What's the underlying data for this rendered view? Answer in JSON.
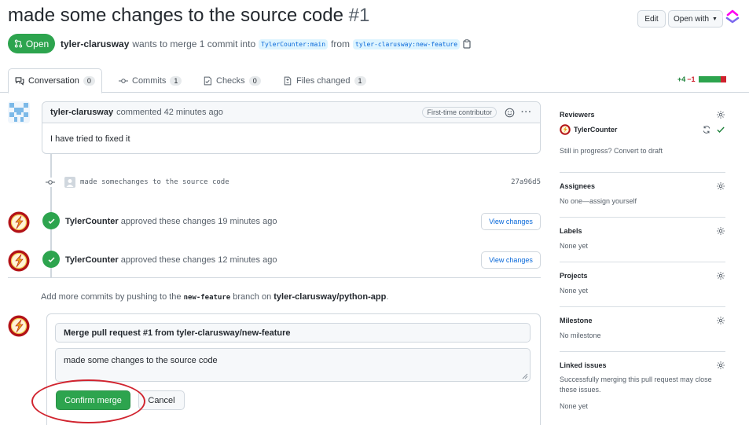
{
  "header": {
    "title": "made some changes to the source code",
    "number": "#1",
    "edit_label": "Edit",
    "open_with_label": "Open with"
  },
  "pr": {
    "state": "Open",
    "author": "tyler-clarusway",
    "merge_text": "wants to merge 1 commit into",
    "base_branch": "TylerCounter:main",
    "from_text": "from",
    "head_branch": "tyler-clarusway:new-feature"
  },
  "tabs": [
    {
      "label": "Conversation",
      "count": "0"
    },
    {
      "label": "Commits",
      "count": "1"
    },
    {
      "label": "Checks",
      "count": "0"
    },
    {
      "label": "Files changed",
      "count": "1"
    }
  ],
  "diffstat": {
    "additions": "+4",
    "deletions": "−1"
  },
  "comment": {
    "author": "tyler-clarusway",
    "meta": "commented 42 minutes ago",
    "badge": "First-time contributor",
    "body": "I have tried to fixed it"
  },
  "commit": {
    "message": "made somechanges to the source code",
    "sha": "27a96d5"
  },
  "reviews": [
    {
      "reviewer": "TylerCounter",
      "text": "approved these changes 19 minutes ago",
      "button": "View changes"
    },
    {
      "reviewer": "TylerCounter",
      "text": "approved these changes 12 minutes ago",
      "button": "View changes"
    }
  ],
  "hint": {
    "prefix": "Add more commits by pushing to the",
    "branch": "new-feature",
    "mid": "branch on",
    "repo": "tyler-clarusway/python-app",
    "suffix": "."
  },
  "merge": {
    "title": "Merge pull request #1 from tyler-clarusway/new-feature",
    "message": "made some changes to the source code",
    "confirm_label": "Confirm merge",
    "cancel_label": "Cancel"
  },
  "sidebar": {
    "reviewers": {
      "heading": "Reviewers",
      "name": "TylerCounter",
      "status": "Still in progress? Convert to draft"
    },
    "assignees": {
      "heading": "Assignees",
      "text": "No one—assign yourself"
    },
    "labels": {
      "heading": "Labels",
      "text": "None yet"
    },
    "projects": {
      "heading": "Projects",
      "text": "None yet"
    },
    "milestone": {
      "heading": "Milestone",
      "text": "No milestone"
    },
    "linked": {
      "heading": "Linked issues",
      "text": "Successfully merging this pull request may close these issues.",
      "text2": "None yet"
    }
  },
  "colors": {
    "green": "#2da44e",
    "red": "#cf222e",
    "link": "#0969da",
    "highlight_ring": "#d1242f"
  }
}
